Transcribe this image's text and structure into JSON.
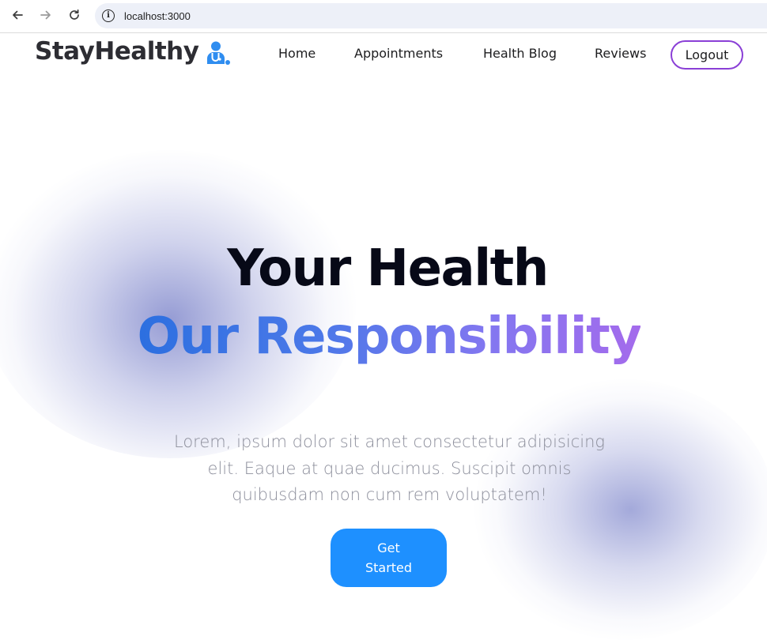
{
  "browser": {
    "url": "localhost:3000",
    "icons": [
      "back-arrow-icon",
      "forward-arrow-icon",
      "reload-icon",
      "info-icon"
    ]
  },
  "navbar": {
    "logo_text": "StayHealthy",
    "logo_icon": "doctor-stethoscope-icon",
    "links": [
      "Home",
      "Appointments",
      "Health Blog",
      "Reviews"
    ],
    "logout_label": "Logout"
  },
  "hero": {
    "title_line1": "Your Health",
    "title_line2": "Our Responsibility",
    "description": "Lorem, ipsum dolor sit amet consectetur adipisicing elit. Eaque at quae ducimus. Suscipit omnis quibusdam non cum rem voluptatem!",
    "cta_label": "Get Started"
  },
  "colors": {
    "accent_blue": "#1e90ff",
    "logout_border": "#8a3fd6",
    "gradient_start": "#2c6fe0",
    "gradient_end": "#a46bec"
  }
}
